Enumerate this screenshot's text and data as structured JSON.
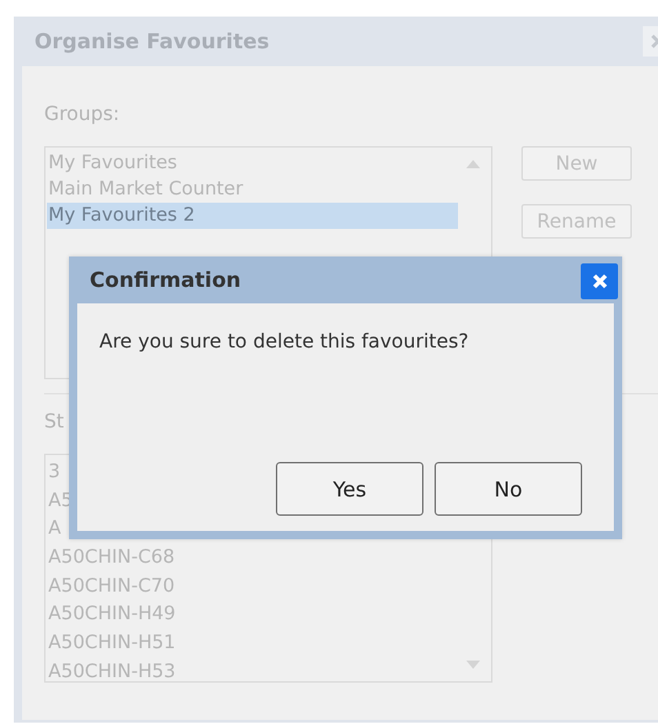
{
  "window": {
    "title": "Organise Favourites"
  },
  "groups": {
    "label": "Groups:",
    "items": [
      {
        "label": "My Favourites",
        "selected": false
      },
      {
        "label": "Main Market Counter",
        "selected": false
      },
      {
        "label": "My Favourites 2",
        "selected": true
      }
    ],
    "buttons": [
      "New",
      "Rename"
    ]
  },
  "stocks": {
    "label": "St",
    "items": [
      "3",
      "A5",
      "A",
      "A50CHIN-C68",
      "A50CHIN-C70",
      "A50CHIN-H49",
      "A50CHIN-H51",
      "A50CHIN-H53"
    ]
  },
  "dialog": {
    "title": "Confirmation",
    "message": "Are you sure to delete this favourites?",
    "buttons": [
      "Yes",
      "No"
    ]
  }
}
